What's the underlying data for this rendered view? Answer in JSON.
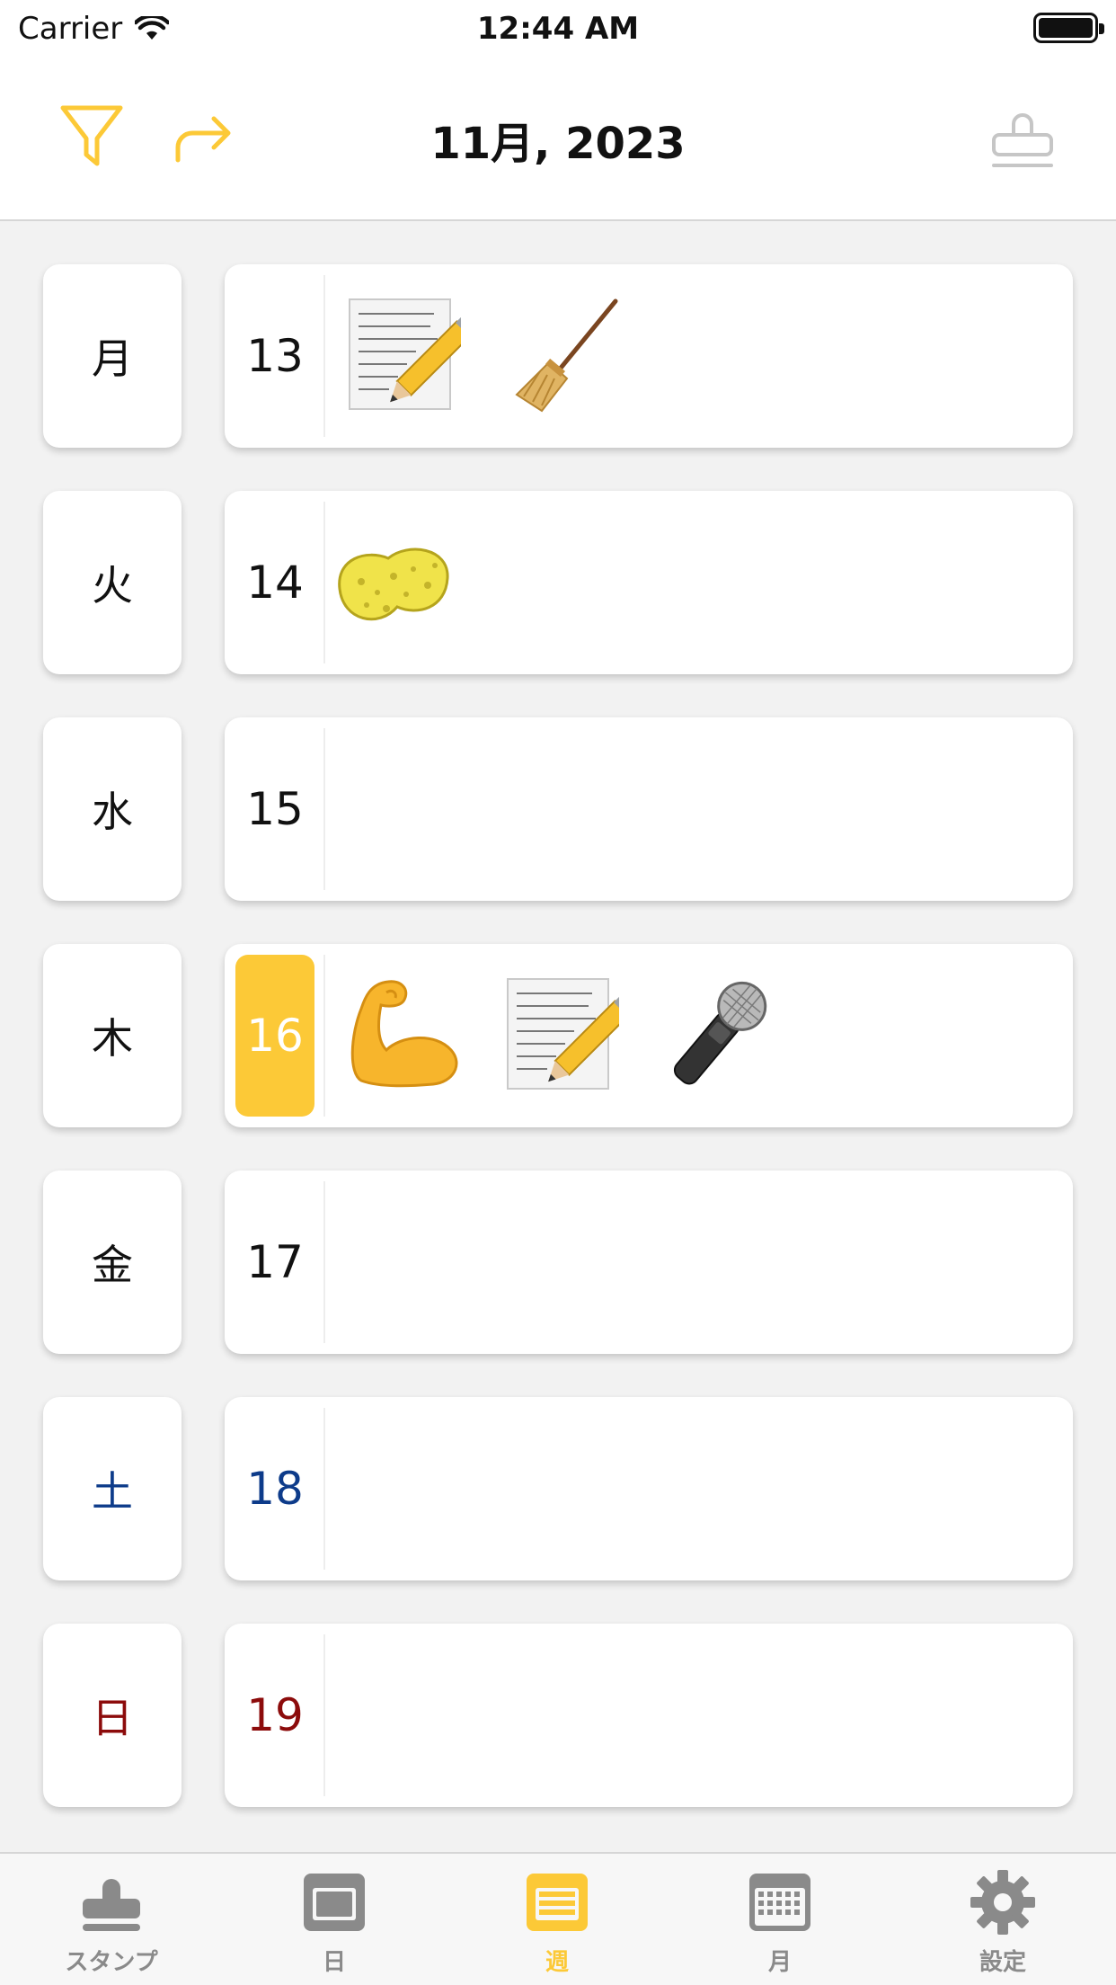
{
  "status_bar": {
    "carrier": "Carrier",
    "time": "12:44 AM"
  },
  "nav": {
    "title": "11月, 2023",
    "left_icons": [
      "filter-icon",
      "redo-icon"
    ],
    "right_icon": "stamp-icon",
    "accent_color": "#fcc937"
  },
  "week": [
    {
      "weekday": "月",
      "date": "13",
      "stamps": [
        "memo-icon",
        "broom-icon"
      ],
      "selected": false
    },
    {
      "weekday": "火",
      "date": "14",
      "stamps": [
        "sponge-icon"
      ],
      "selected": false
    },
    {
      "weekday": "水",
      "date": "15",
      "stamps": [],
      "selected": false
    },
    {
      "weekday": "木",
      "date": "16",
      "stamps": [
        "flexed-biceps-icon",
        "memo-icon",
        "microphone-icon"
      ],
      "selected": true
    },
    {
      "weekday": "金",
      "date": "17",
      "stamps": [],
      "selected": false
    },
    {
      "weekday": "土",
      "date": "18",
      "stamps": [],
      "selected": false,
      "color": "#0d3b8a"
    },
    {
      "weekday": "日",
      "date": "19",
      "stamps": [],
      "selected": false,
      "color": "#8c0b0b"
    }
  ],
  "tabs": [
    {
      "label": "スタンプ",
      "icon": "stamp-icon"
    },
    {
      "label": "日",
      "icon": "day-view-icon"
    },
    {
      "label": "週",
      "icon": "week-view-icon",
      "active": true
    },
    {
      "label": "月",
      "icon": "month-view-icon"
    },
    {
      "label": "設定",
      "icon": "gear-icon"
    }
  ]
}
